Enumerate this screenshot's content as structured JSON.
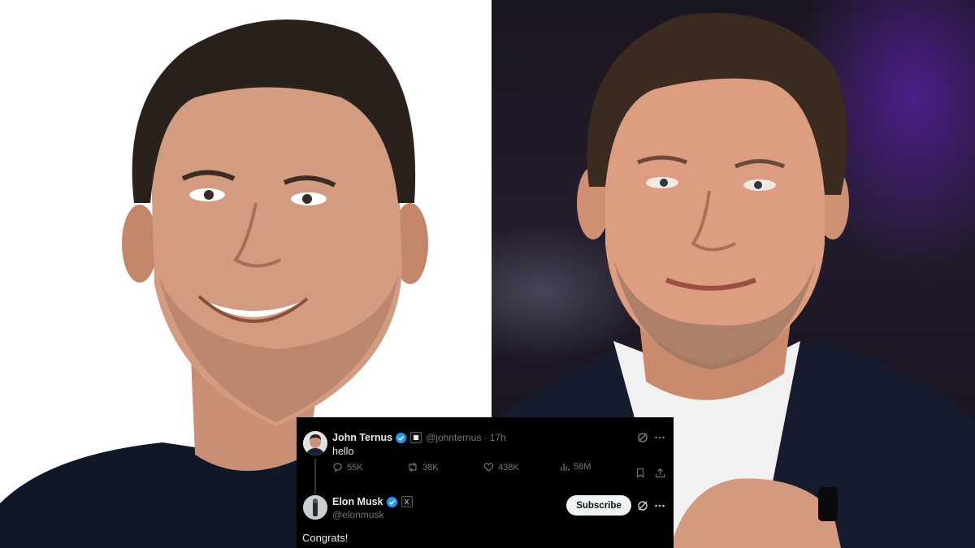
{
  "tweet": {
    "author_name": "John Ternus",
    "author_handle": "@johnternus",
    "time": "· 17h",
    "text": "hello",
    "stats": {
      "replies": "55K",
      "reposts": "38K",
      "likes": "438K",
      "views": "58M"
    }
  },
  "reply": {
    "author_name": "Elon Musk",
    "author_handle": "@elonmusk",
    "affiliate_badge": "X",
    "subscribe_label": "Subscribe",
    "text": "Congrats!"
  },
  "colors": {
    "verified": "#1d9bf0",
    "card_bg": "#000000",
    "muted_text": "#71767b",
    "primary_text": "#e7e9ea"
  },
  "icons": [
    "verified-badge-icon",
    "affiliate-badge-icon",
    "grok-icon",
    "more-icon",
    "reply-icon",
    "repost-icon",
    "like-icon",
    "views-icon",
    "bookmark-icon",
    "share-icon"
  ]
}
